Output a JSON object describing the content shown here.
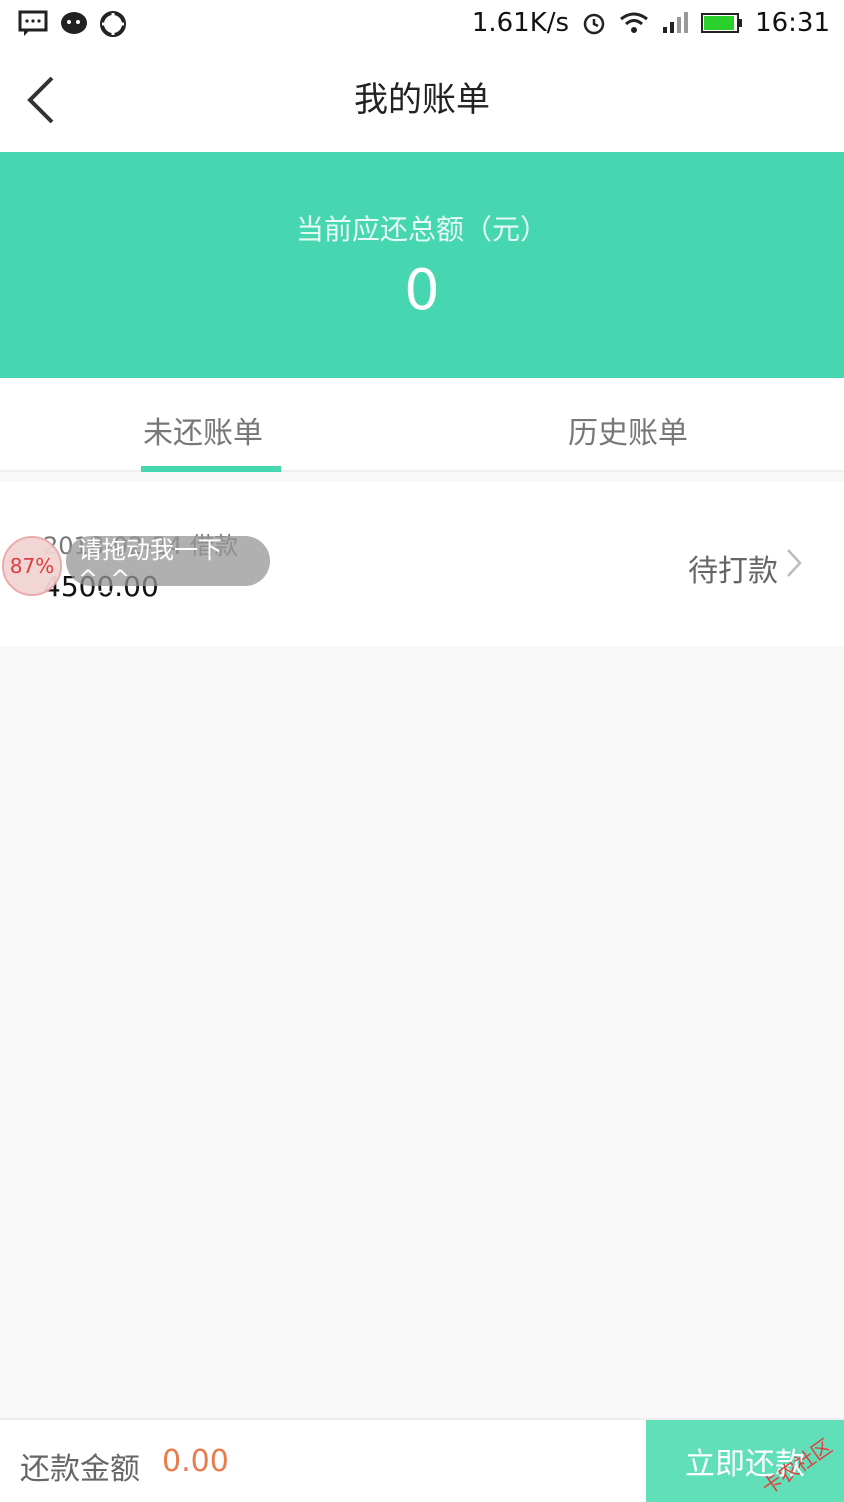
{
  "status_bar": {
    "net_speed": "1.61K/s",
    "time": "16:31"
  },
  "header": {
    "title": "我的账单"
  },
  "summary": {
    "label": "当前应还总额（元）",
    "amount": "0"
  },
  "tabs": [
    {
      "label": "未还账单",
      "active": true
    },
    {
      "label": "历史账单",
      "active": false
    }
  ],
  "bills": [
    {
      "date_type": "2018-02-24  借款",
      "amount": "4500.00",
      "status": "待打款"
    }
  ],
  "floating_widget": {
    "percent": "87%",
    "hint": "请拖动我一下^_^"
  },
  "bottom": {
    "pay_label": "还款金额",
    "pay_amount": "0.00",
    "pay_button": "立即还款"
  },
  "watermark": "卡农社区",
  "colors": {
    "accent": "#46d7b1",
    "button": "#61dfb9",
    "amount_orange": "#e77c4e"
  }
}
